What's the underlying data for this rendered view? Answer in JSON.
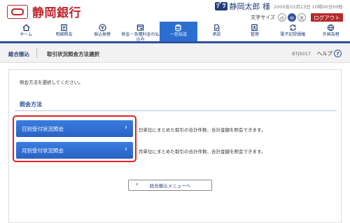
{
  "header": {
    "bank_name": "静岡銀行",
    "user_badge": "ｿﾞﾂ",
    "user_name": "静岡太郎 様",
    "last_login": "2000年02月13日 10時00分00秒",
    "font_size_label": "文字サイズ",
    "font_sizes": [
      "小",
      "中",
      "大"
    ],
    "logout_label": "ログアウト"
  },
  "nav": {
    "items": [
      {
        "label": "ホーム",
        "icon": "home-icon"
      },
      {
        "label": "明細照会",
        "icon": "ledger-icon"
      },
      {
        "label": "振込振替",
        "icon": "yen-icon"
      },
      {
        "label": "税金・各種料金の払込み",
        "icon": "payment-icon"
      },
      {
        "label": "一括伝送",
        "icon": "database-icon"
      },
      {
        "label": "承認",
        "icon": "approval-icon"
      },
      {
        "label": "管理",
        "icon": "management-icon"
      },
      {
        "label": "電子記録債権",
        "icon": "e-receivable-icon"
      },
      {
        "label": "外国為替",
        "icon": "forex-icon"
      }
    ]
  },
  "titlebar": {
    "breadcrumb": "総合振込",
    "title": "取引状況照会方法選択",
    "screen_id": "BTJS017",
    "help_label": "ヘルプ",
    "help_icon_glyph": "?"
  },
  "main": {
    "instruction": "照会方法を選択してください。",
    "section_title": "照会方法",
    "options": [
      {
        "label": "日別受付状況照会",
        "description": "日単位にまとめた取引の合計件数、合計金額を照会できます。"
      },
      {
        "label": "月別受付状況照会",
        "description": "月単位にまとめた取引の合計件数、合計金額を照会できます。"
      }
    ],
    "back_label": "総合振込メニューへ"
  },
  "colors": {
    "brand_red": "#c0262d",
    "nav_blue": "#2d4f9c",
    "button_blue": "#2d6fd0",
    "highlight_red": "#e02020"
  }
}
